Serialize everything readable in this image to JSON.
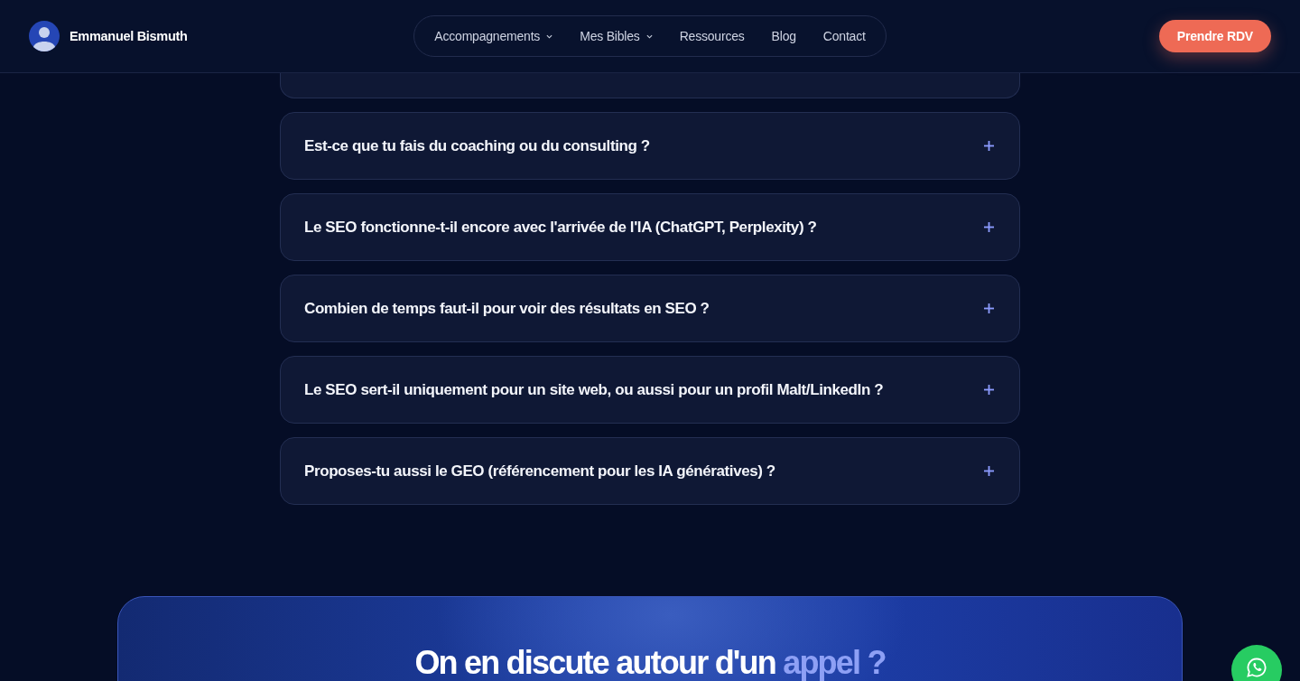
{
  "header": {
    "brand": {
      "name": "Emmanuel Bismuth"
    },
    "nav": [
      {
        "label": "Accompagnements",
        "dropdown": true
      },
      {
        "label": "Mes Bibles",
        "dropdown": true
      },
      {
        "label": "Ressources",
        "dropdown": false
      },
      {
        "label": "Blog",
        "dropdown": false
      },
      {
        "label": "Contact",
        "dropdown": false
      }
    ],
    "cta": "Prendre RDV"
  },
  "faq": {
    "items": [
      {
        "question": "Est-ce que tu fais du coaching ou du consulting ?",
        "expanded": false
      },
      {
        "question": "Le SEO fonctionne-t-il encore avec l'arrivée de l'IA (ChatGPT, Perplexity) ?",
        "expanded": false
      },
      {
        "question": "Combien de temps faut-il pour voir des résultats en SEO ?",
        "expanded": false
      },
      {
        "question": "Le SEO sert-il uniquement pour un site web, ou aussi pour un profil Malt/LinkedIn ?",
        "expanded": false
      },
      {
        "question": "Proposes-tu aussi le GEO (référencement pour les IA génératives) ?",
        "expanded": false
      }
    ]
  },
  "cta_section": {
    "heading": "On en discute autour d'un",
    "heading_accent": "appel ?"
  }
}
